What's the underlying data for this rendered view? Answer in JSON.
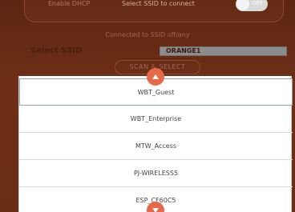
{
  "header": {
    "left_text": "Enable DHCP",
    "mid_text": "Select SSID to connect",
    "toggle_label": "OFF"
  },
  "status": {
    "connected_text": "Connected to SSID off/any"
  },
  "ssid": {
    "label": "Select SSID",
    "value": "ORANGE1"
  },
  "scan_button": {
    "label": "SCAN & SELECT"
  },
  "dropdown": {
    "options": [
      {
        "label": "WBT_Guest"
      },
      {
        "label": "WBT_Enterprise"
      },
      {
        "label": "MTW_Access"
      },
      {
        "label": "PJ-WIRELESS5"
      },
      {
        "label": "ESP_CF60C5"
      }
    ],
    "selected_index": 0
  },
  "colors": {
    "background": "#6b2e16",
    "accent": "#e8684a"
  },
  "icons": {
    "scroll_up": "chevron-up-icon",
    "scroll_down": "chevron-down-icon"
  }
}
